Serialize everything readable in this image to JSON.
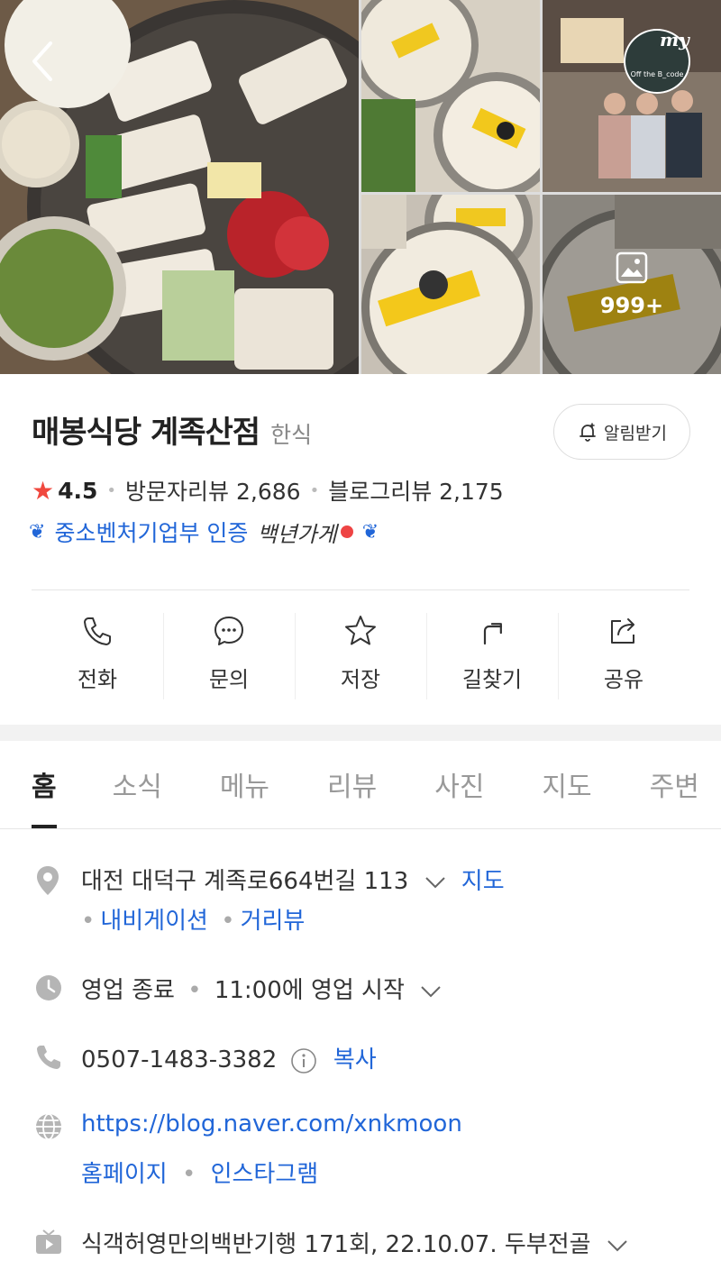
{
  "photos": {
    "more_count": "999+",
    "badge_my": "my",
    "badge_sub": "Off the B_code"
  },
  "store": {
    "name": "매봉식당 계족산점",
    "category": "한식",
    "notify_label": "알림받기",
    "rating": "4.5",
    "visitor_reviews": "방문자리뷰 2,686",
    "blog_reviews": "블로그리뷰 2,175",
    "certification": "중소벤처기업부 인증",
    "certification_mark": "백년가게"
  },
  "actions": [
    {
      "label": "전화",
      "icon": "phone-icon"
    },
    {
      "label": "문의",
      "icon": "chat-icon"
    },
    {
      "label": "저장",
      "icon": "star-outline-icon"
    },
    {
      "label": "길찾기",
      "icon": "directions-icon"
    },
    {
      "label": "공유",
      "icon": "share-icon"
    }
  ],
  "tabs": [
    "홈",
    "소식",
    "메뉴",
    "리뷰",
    "사진",
    "지도",
    "주변"
  ],
  "info": {
    "address": "대전 대덕구 계족로664번길 113",
    "map_link": "지도",
    "navigation_link": "내비게이션",
    "street_view_link": "거리뷰",
    "hours_status": "영업 종료",
    "hours_next": "11:00에 영업 시작",
    "phone": "0507-1483-3382",
    "copy_label": "복사",
    "website": "https://blog.naver.com/xnkmoon",
    "homepage_link": "홈페이지",
    "instagram_link": "인스타그램",
    "tv_appearance": "식객허영만의백반기행 171회, 22.10.07. 두부전골"
  },
  "colors": {
    "accent_blue": "#2166d8",
    "star_red": "#f0483e"
  }
}
